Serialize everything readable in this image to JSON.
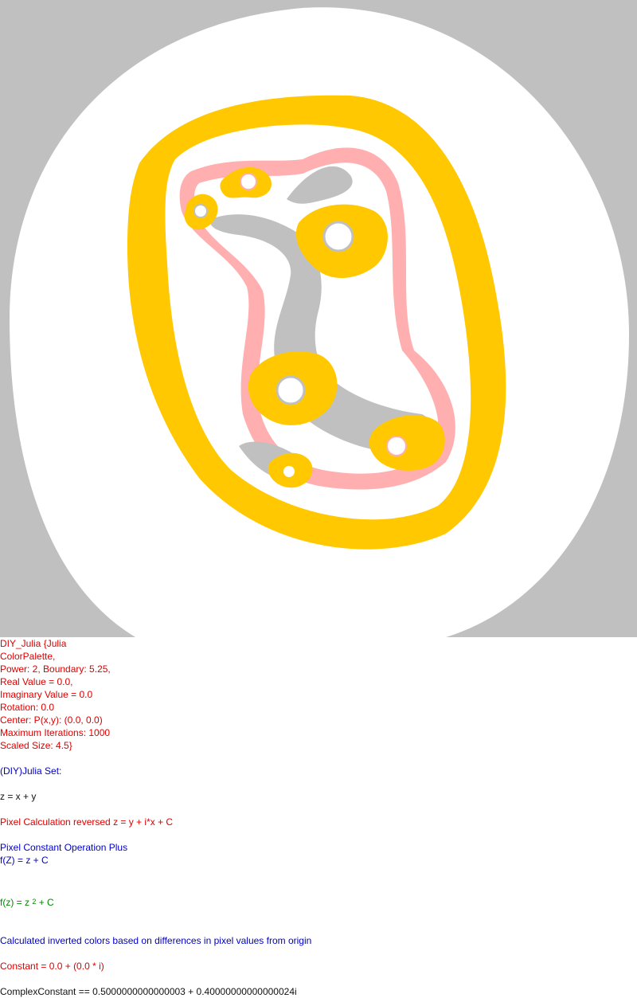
{
  "colors": {
    "background": "#c0c0c0",
    "outer_band": "#ffffff",
    "gold": "#ffc800",
    "pink": "#ffafaf",
    "gray": "#c0c0c0",
    "red_text": "#dd0000",
    "blue_text": "#0000cc",
    "green_text": "#008800"
  },
  "params": {
    "header": "DIY_Julia {Julia",
    "palette": "ColorPalette,",
    "power_boundary": "Power: 2, Boundary: 5.25,",
    "real": "Real Value = 0.0,",
    "imag": "Imaginary Value = 0.0",
    "rotation": "Rotation: 0.0",
    "center": "Center: P(x,y): (0.0, 0.0)",
    "max_iter": "Maximum Iterations: 1000",
    "scaled": "Scaled Size: 4.5}"
  },
  "info": {
    "set_title": "(DIY)Julia Set:",
    "z_def": "z = x + y",
    "pixel_calc": "Pixel Calculation reversed z = y + i*x + C",
    "const_op": "Pixel Constant Operation Plus",
    "fz_plus": "f(Z) = z + C",
    "formula_prefix": "f(z) = z ",
    "formula_exp": "2",
    "formula_suffix": " + C",
    "colors_note": "Calculated inverted colors based on differences in pixel values from origin",
    "constant": "Constant = 0.0 + (0.0 * i)",
    "complex_constant": "ComplexConstant == 0.5000000000000003 + 0.40000000000000024i"
  }
}
